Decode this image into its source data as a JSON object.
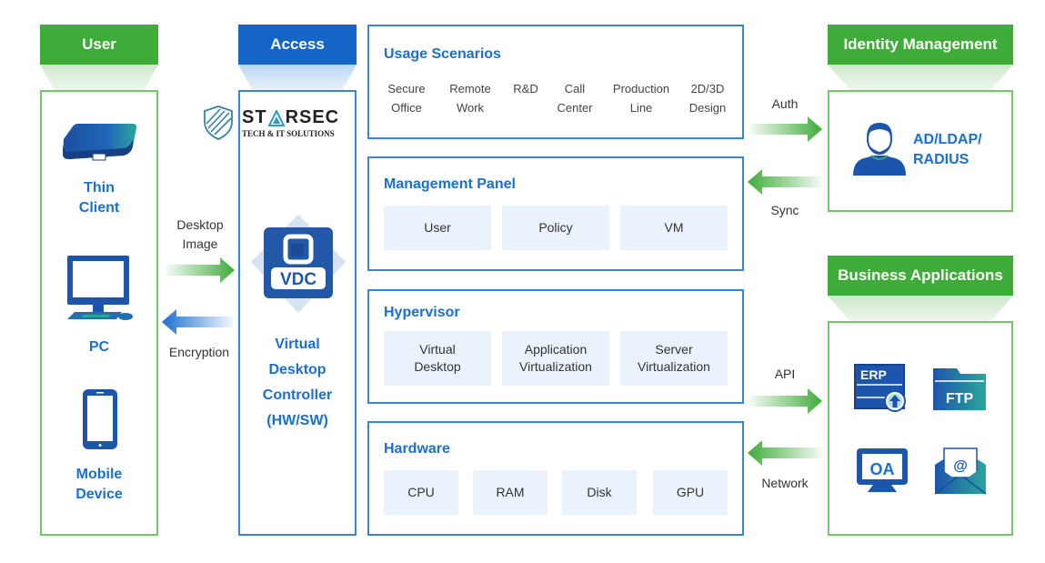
{
  "columns": {
    "user": {
      "header": "User",
      "devices": [
        {
          "icon": "thin-client-icon",
          "label_line1": "Thin",
          "label_line2": "Client"
        },
        {
          "icon": "pc-icon",
          "label_line1": "PC",
          "label_line2": ""
        },
        {
          "icon": "mobile-device-icon",
          "label_line1": "Mobile",
          "label_line2": "Device"
        }
      ]
    },
    "access": {
      "header": "Access",
      "logo": {
        "name": "ST▲RSEC",
        "brand_left": "ST",
        "brand_right": "RSEC",
        "tagline": "TECH & IT SOLUTIONS"
      },
      "vdc_badge": "VDC",
      "controller_lines": [
        "Virtual",
        "Desktop",
        "Controller",
        "(HW/SW)"
      ]
    },
    "identity": {
      "header": "Identity Management",
      "label_line1": "AD/LDAP/",
      "label_line2": "RADIUS"
    },
    "business": {
      "header": "Business Applications",
      "apps": [
        {
          "icon": "erp-icon",
          "label": "ERP"
        },
        {
          "icon": "ftp-icon",
          "label": "FTP"
        },
        {
          "icon": "oa-icon",
          "label": "OA"
        },
        {
          "icon": "email-icon",
          "label": "@"
        }
      ]
    }
  },
  "panels": {
    "usage": {
      "title": "Usage Scenarios",
      "items": [
        {
          "line1": "Secure",
          "line2": "Office"
        },
        {
          "line1": "Remote",
          "line2": "Work"
        },
        {
          "line1": "R&D",
          "line2": ""
        },
        {
          "line1": "Call",
          "line2": "Center"
        },
        {
          "line1": "Production",
          "line2": "Line"
        },
        {
          "line1": "2D/3D",
          "line2": "Design"
        }
      ]
    },
    "management": {
      "title": "Management Panel",
      "items": [
        "User",
        "Policy",
        "VM"
      ]
    },
    "hypervisor": {
      "title": "Hypervisor",
      "items": [
        {
          "line1": "Virtual",
          "line2": "Desktop"
        },
        {
          "line1": "Application",
          "line2": "Virtualization"
        },
        {
          "line1": "Server",
          "line2": "Virtualization"
        }
      ]
    },
    "hardware": {
      "title": "Hardware",
      "items": [
        "CPU",
        "RAM",
        "Disk",
        "GPU"
      ]
    }
  },
  "flows": {
    "desktop_image": {
      "line1": "Desktop",
      "line2": "Image"
    },
    "encryption": "Encryption",
    "auth": "Auth",
    "sync": "Sync",
    "api": "API",
    "network": "Network"
  },
  "colors": {
    "green": "#3fac3a",
    "blue": "#1565c8",
    "text_blue": "#1a6fcf",
    "cell_bg": "#eaf3fc"
  }
}
